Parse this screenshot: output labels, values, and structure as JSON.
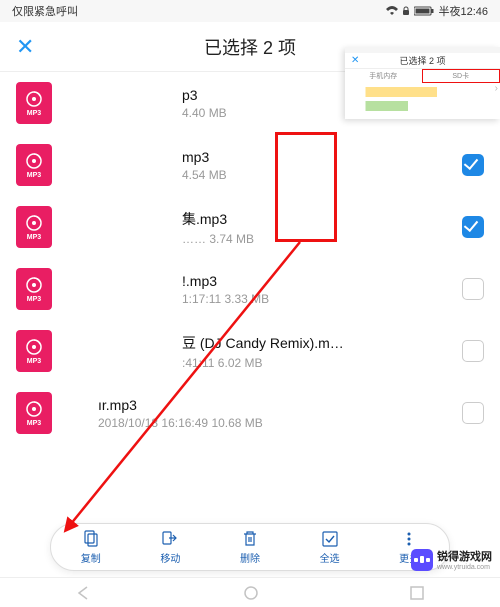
{
  "status": {
    "left": "仅限紧急呼叫",
    "time": "半夜12:46"
  },
  "header": {
    "title": "已选择 2 项"
  },
  "files": [
    {
      "name": "p3",
      "meta": "4.40 MB",
      "checked": false
    },
    {
      "name": "mp3",
      "meta": "4.54 MB",
      "checked": true
    },
    {
      "name": "集.mp3",
      "meta": "…… 3.74 MB",
      "checked": true
    },
    {
      "name": "!.mp3",
      "meta": "1:17:11 3.33 MB",
      "checked": false
    },
    {
      "name": "豆 (DJ Candy Remix).m…",
      "meta": ":41:11 6.02 MB",
      "checked": false
    },
    {
      "name": "ır.mp3",
      "meta": "2018/10/18 16:16:49 10.68 MB",
      "checked": false
    }
  ],
  "icon_label": "MP3",
  "actions": {
    "copy": "复制",
    "move": "移动",
    "delete": "删除",
    "select_all": "全选",
    "more": "更多"
  },
  "pip": {
    "title": "已选择 2 项",
    "tab1": "手机内存",
    "tab2": "SD卡"
  },
  "watermark": {
    "name": "锐得游戏网",
    "url": "www.ytruida.com"
  }
}
